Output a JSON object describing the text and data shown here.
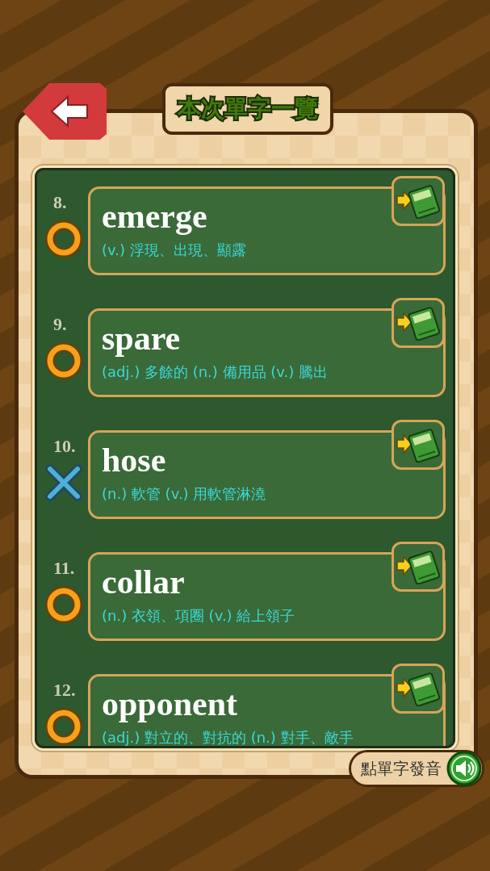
{
  "title": "本次單字一覽",
  "words": [
    {
      "number": "8.",
      "word": "emerge",
      "definition": "(v.) 浮現、出現、顯露",
      "correct": true
    },
    {
      "number": "9.",
      "word": "spare",
      "definition": "(adj.) 多餘的 (n.) 備用品 (v.) 騰出",
      "correct": true
    },
    {
      "number": "10.",
      "word": "hose",
      "definition": "(n.) 軟管 (v.) 用軟管淋澆",
      "correct": false
    },
    {
      "number": "11.",
      "word": "collar",
      "definition": "(n.) 衣領、項圈 (v.) 給上領子",
      "correct": true
    },
    {
      "number": "12.",
      "word": "opponent",
      "definition": "(adj.) 對立的、對抗的 (n.) 對手、敵手",
      "correct": true
    }
  ],
  "pronounce_button": "點單字發音"
}
